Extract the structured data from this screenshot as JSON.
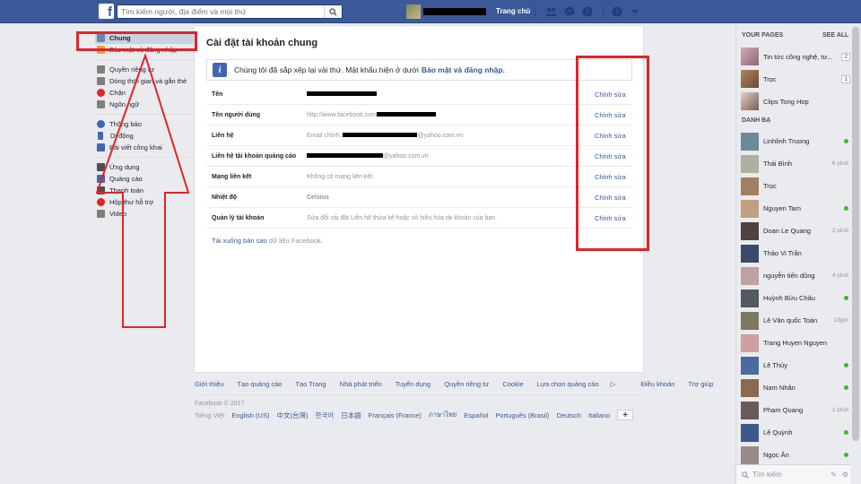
{
  "topbar": {
    "search_placeholder": "Tìm kiếm người, địa điểm và mọi thứ",
    "home": "Trang chủ"
  },
  "leftnav": {
    "items": [
      {
        "label": "Chung",
        "icon": "gear-icon",
        "color": "#6d84b4"
      },
      {
        "label": "Bảo mật và đăng nhập",
        "icon": "lock-icon",
        "color": "#e8a33a"
      },
      {
        "label": "Quyền riêng tư",
        "icon": "privacy-icon",
        "color": "#7f7f7f"
      },
      {
        "label": "Dòng thời gian và gắn thẻ",
        "icon": "timeline-icon",
        "color": "#7f7f7f"
      },
      {
        "label": "Chặn",
        "icon": "block-icon",
        "color": "#e0242a"
      },
      {
        "label": "Ngôn ngữ",
        "icon": "language-icon",
        "color": "#7f7f7f"
      },
      {
        "label": "Thông báo",
        "icon": "globe-icon",
        "color": "#4267b2"
      },
      {
        "label": "Di động",
        "icon": "mobile-icon",
        "color": "#4267b2"
      },
      {
        "label": "Bài viết công khai",
        "icon": "rss-icon",
        "color": "#4267b2"
      },
      {
        "label": "Ứng dụng",
        "icon": "apps-icon",
        "color": "#4b4f56"
      },
      {
        "label": "Quảng cáo",
        "icon": "ads-icon",
        "color": "#4267b2"
      },
      {
        "label": "Thanh toán",
        "icon": "payment-icon",
        "color": "#4b4f56"
      },
      {
        "label": "Hộp thư hỗ trợ",
        "icon": "support-icon",
        "color": "#e0242a"
      },
      {
        "label": "Video",
        "icon": "video-icon",
        "color": "#7f7f7f"
      }
    ]
  },
  "main": {
    "title": "Cài đặt tài khoản chung",
    "info_text": "Chúng tôi đã sắp xếp lại vài thứ. Mật khẩu hiện ở dưới ",
    "info_link": "Bảo mật và đăng nhập.",
    "edit_label": "Chỉnh sửa",
    "rows": [
      {
        "label": "Tên",
        "prefix": "",
        "suffix": ""
      },
      {
        "label": "Tên người dùng",
        "prefix": "http://www.facebook.com",
        "suffix": ""
      },
      {
        "label": "Liên hệ",
        "prefix": "Email chính: ",
        "suffix": "@yahoo.com.vn"
      },
      {
        "label": "Liên hệ tài khoản quảng cáo",
        "prefix": "",
        "suffix": "@yahoo.com.vn"
      },
      {
        "label": "Mạng liên kết",
        "prefix": "Không có mạng liên kết.",
        "suffix": ""
      },
      {
        "label": "Nhiệt độ",
        "prefix": "Celsius",
        "suffix": ""
      },
      {
        "label": "Quản lý tài khoản",
        "prefix": "Sửa đổi cài đặt Liên hệ thừa kế hoặc vô hiệu hóa tài khoản của bạn.",
        "suffix": ""
      }
    ],
    "download_link": "Tải xuống bản sao",
    "download_rest": " dữ liệu Facebook."
  },
  "footer": {
    "links": [
      "Giới thiệu",
      "Tạo quảng cáo",
      "Tạo Trang",
      "Nhà phát triển",
      "Tuyển dụng",
      "Quyền riêng tư",
      "Cookie",
      "Lựa chọn quảng cáo",
      "Điều khoản",
      "Trợ giúp"
    ],
    "copyright": "Facebook © 2017",
    "current_lang": "Tiếng Việt",
    "langs": [
      "English (US)",
      "中文(台灣)",
      "한국어",
      "日本語",
      "Français (France)",
      "ภาษาไทย",
      "Español",
      "Português (Brasil)",
      "Deutsch",
      "Italiano"
    ]
  },
  "sidebar": {
    "pages_header": "YOUR PAGES",
    "see_all": "SEE ALL",
    "pages": [
      {
        "name": "Tin tức công nghệ, tư...",
        "count": "2"
      },
      {
        "name": "Trọc",
        "count": "1"
      },
      {
        "name": "Clips Tong Hop",
        "count": ""
      }
    ],
    "contacts_header": "DANH BẠ",
    "contacts": [
      {
        "name": "Linhlinh Truong",
        "time": ""
      },
      {
        "name": "Thái Bình",
        "time": "6 phút"
      },
      {
        "name": "Trọc",
        "time": ""
      },
      {
        "name": "Nguyen Tam",
        "time": ""
      },
      {
        "name": "Doan Le Quang",
        "time": "2 phút"
      },
      {
        "name": "Thảo Vi Trần",
        "time": ""
      },
      {
        "name": "nguyễn tiến dũng",
        "time": "4 phút"
      },
      {
        "name": "Huỳnh Bửu Châu",
        "time": ""
      },
      {
        "name": "Lê Văn quốc Toàn",
        "time": "13giờ"
      },
      {
        "name": "Trang Huyen Nguyen",
        "time": ""
      },
      {
        "name": "Lê Thủy",
        "time": ""
      },
      {
        "name": "Nam Nhân",
        "time": ""
      },
      {
        "name": "Phạm Quang",
        "time": "1 phút"
      },
      {
        "name": "Lê Quỳnh",
        "time": ""
      },
      {
        "name": "Ngọc Ân",
        "time": ""
      }
    ],
    "search_placeholder": "Tìm kiếm"
  }
}
